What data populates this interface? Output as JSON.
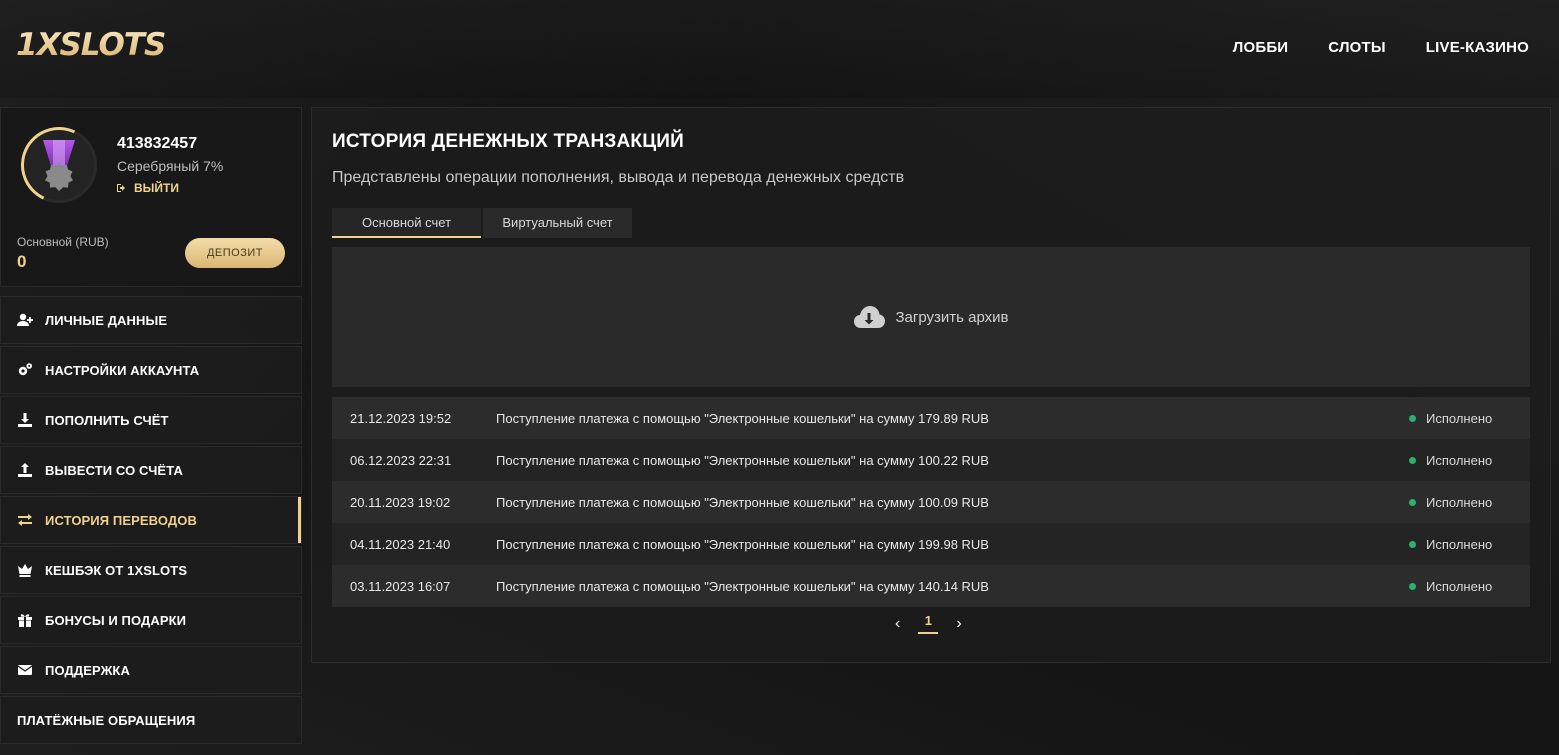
{
  "header": {
    "logo": "1XSLOTS",
    "nav": [
      {
        "label": "ЛОББИ"
      },
      {
        "label": "СЛОТЫ"
      },
      {
        "label": "LIVE-КАЗИНО"
      }
    ]
  },
  "profile": {
    "user_id": "413832457",
    "level": "Серебряный 7%",
    "logout_label": "ВЫЙТИ",
    "balance_label": "Основной (RUB)",
    "balance_value": "0",
    "deposit_label": "ДЕПОЗИТ"
  },
  "sidebar": {
    "items": [
      {
        "label": "ЛИЧНЫЕ ДАННЫЕ",
        "icon": "user-plus-icon"
      },
      {
        "label": "НАСТРОЙКИ АККАУНТА",
        "icon": "gears-icon"
      },
      {
        "label": "ПОПОЛНИТЬ СЧЁТ",
        "icon": "download-icon"
      },
      {
        "label": "ВЫВЕСТИ СО СЧЁТА",
        "icon": "upload-icon"
      },
      {
        "label": "ИСТОРИЯ ПЕРЕВОДОВ",
        "icon": "exchange-icon",
        "active": true
      },
      {
        "label": "КЕШБЭК ОТ 1XSLOTS",
        "icon": "crown-icon"
      },
      {
        "label": "БОНУСЫ И ПОДАРКИ",
        "icon": "gift-icon"
      },
      {
        "label": "ПОДДЕРЖКА",
        "icon": "envelope-icon"
      },
      {
        "label": "ПЛАТЁЖНЫЕ ОБРАЩЕНИЯ",
        "icon": ""
      }
    ]
  },
  "main": {
    "title": "ИСТОРИЯ ДЕНЕЖНЫХ ТРАНЗАКЦИЙ",
    "subtitle": "Представлены операции пополнения, вывода и перевода денежных средств",
    "tabs": [
      {
        "label": "Основной счет",
        "active": true
      },
      {
        "label": "Виртуальный счет",
        "active": false
      }
    ],
    "archive_label": "Загрузить архив",
    "transactions": [
      {
        "date": "21.12.2023 19:52",
        "description": "Поступление платежа с помощью \"Электронные кошельки\" на сумму 179.89 RUB",
        "status": "Исполнено"
      },
      {
        "date": "06.12.2023 22:31",
        "description": "Поступление платежа с помощью \"Электронные кошельки\" на сумму 100.22 RUB",
        "status": "Исполнено"
      },
      {
        "date": "20.11.2023 19:02",
        "description": "Поступление платежа с помощью \"Электронные кошельки\" на сумму 100.09 RUB",
        "status": "Исполнено"
      },
      {
        "date": "04.11.2023 21:40",
        "description": "Поступление платежа с помощью \"Электронные кошельки\" на сумму 199.98 RUB",
        "status": "Исполнено"
      },
      {
        "date": "03.11.2023 16:07",
        "description": "Поступление платежа с помощью \"Электронные кошельки\" на сумму 140.14 RUB",
        "status": "Исполнено"
      }
    ],
    "pagination": {
      "current": "1",
      "prev": "‹",
      "next": "›"
    }
  },
  "colors": {
    "accent": "#f0d28c",
    "status_ok": "#29b36b",
    "panel": "#1c1c1c"
  }
}
